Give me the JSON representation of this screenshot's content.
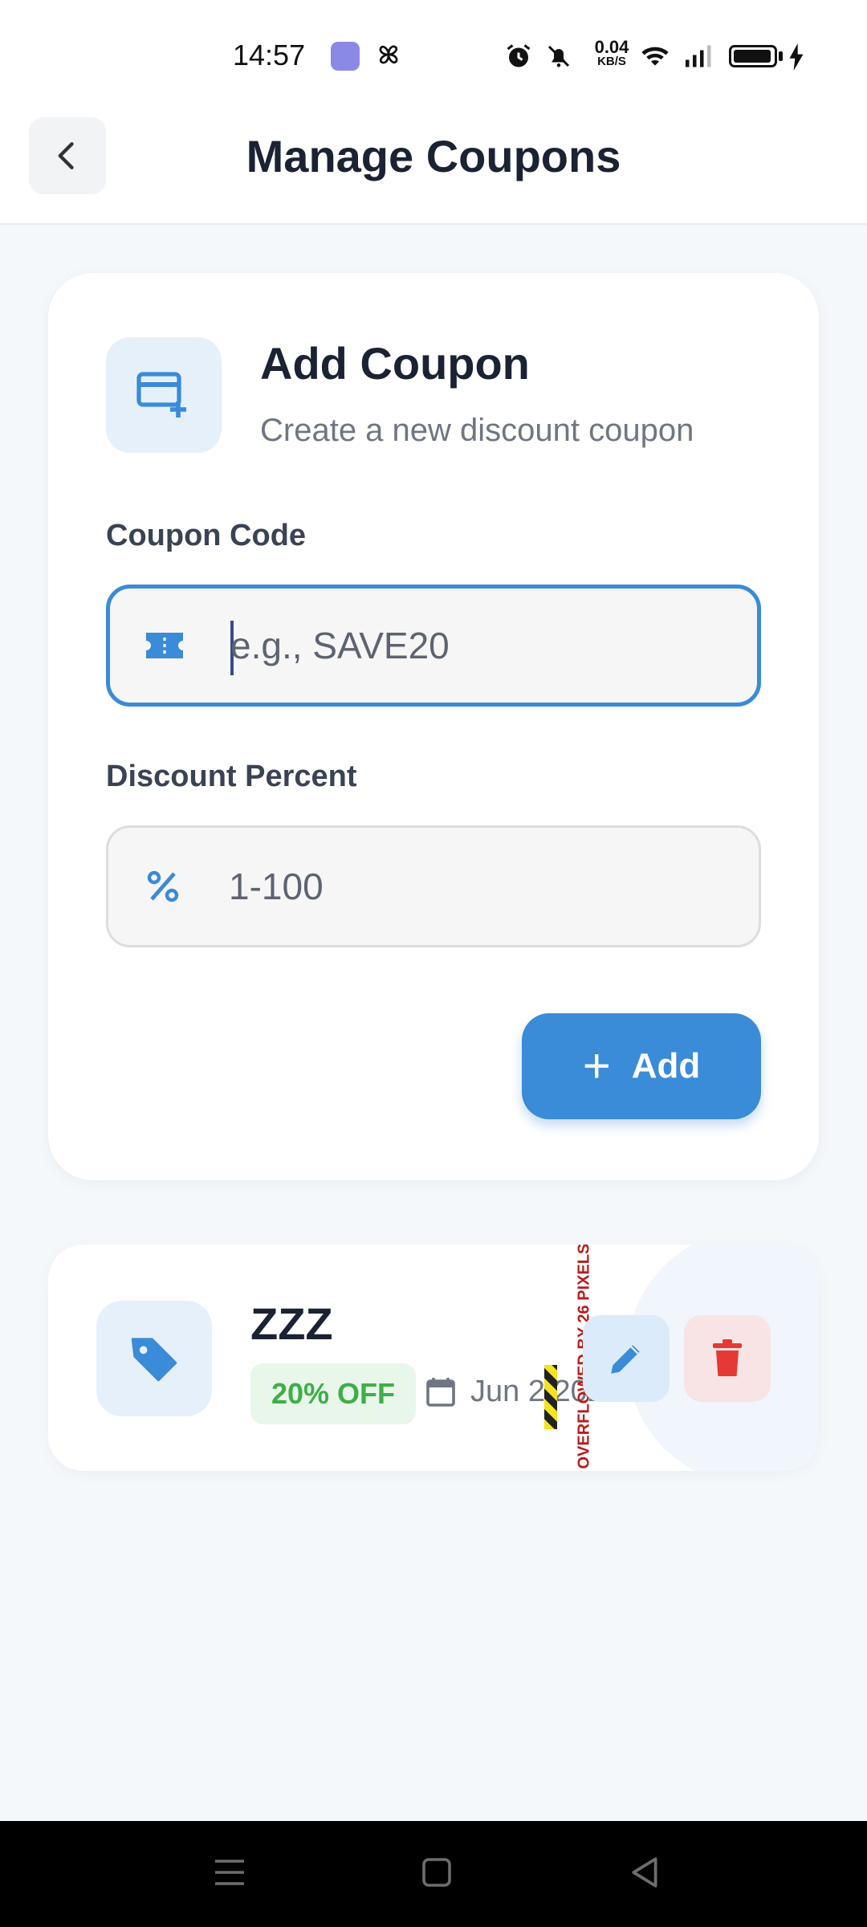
{
  "status_bar": {
    "time": "14:57",
    "net_speed": "0.04",
    "net_unit": "KB/S",
    "icons": [
      "app-notification-icon",
      "pinwheel-icon",
      "alarm-icon",
      "silent-icon",
      "wifi-icon",
      "signal-icon",
      "battery-icon",
      "charging-icon"
    ]
  },
  "header": {
    "title": "Manage Coupons",
    "back_icon": "chevron-left-icon"
  },
  "add_card": {
    "title": "Add Coupon",
    "subtitle": "Create a new discount coupon",
    "icon": "card-add-icon",
    "coupon_code": {
      "label": "Coupon Code",
      "placeholder": "e.g., SAVE20",
      "value": "",
      "icon": "ticket-icon"
    },
    "discount_percent": {
      "label": "Discount Percent",
      "placeholder": "1-100",
      "value": "",
      "icon": "percent-icon"
    },
    "add_button": {
      "label": "Add",
      "icon": "plus-icon"
    }
  },
  "coupons": [
    {
      "code": "ZZZ",
      "discount_badge": "20% OFF",
      "date": "Jun 2 2025",
      "icon": "tag-icon",
      "actions": [
        "edit-icon",
        "trash-icon"
      ]
    }
  ],
  "overflow_warning": "OVERFLOWED BY 26 PIXELS",
  "colors": {
    "accent": "#3a8bd8",
    "success": "#3fae48",
    "danger": "#e53935",
    "background": "#f5f8fb"
  },
  "nav_bar": {
    "icons": [
      "menu-icon",
      "home-icon",
      "back-icon"
    ]
  }
}
